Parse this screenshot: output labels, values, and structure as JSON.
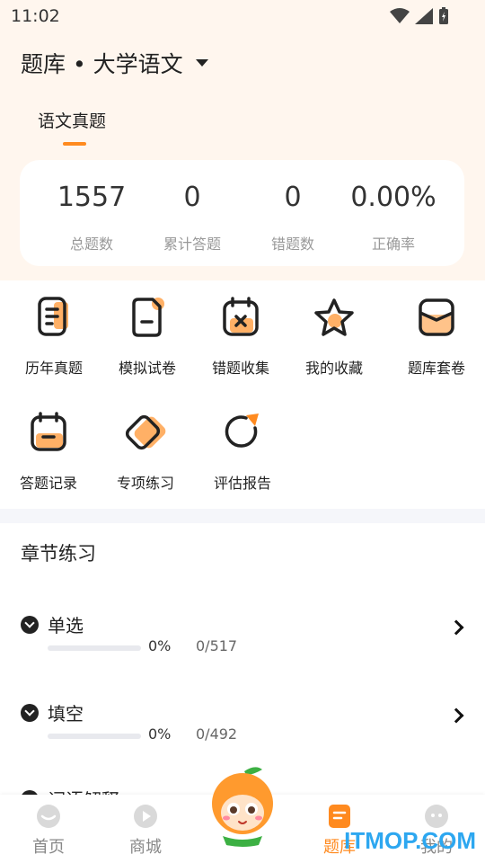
{
  "status_bar": {
    "time": "11:02"
  },
  "header": {
    "title": "题库 • 大学语文"
  },
  "tabs": [
    {
      "label": "语文真题",
      "active": true
    }
  ],
  "stats": [
    {
      "value": "1557",
      "label": "总题数"
    },
    {
      "value": "0",
      "label": "累计答题"
    },
    {
      "value": "0",
      "label": "错题数"
    },
    {
      "value": "0.00%",
      "label": "正确率"
    }
  ],
  "features": [
    {
      "label": "历年真题",
      "icon": "past-papers-icon"
    },
    {
      "label": "模拟试卷",
      "icon": "mock-exam-icon"
    },
    {
      "label": "错题收集",
      "icon": "wrong-collection-icon"
    },
    {
      "label": "我的收藏",
      "icon": "star-icon"
    },
    {
      "label": "题库套卷",
      "icon": "paper-set-icon"
    },
    {
      "label": "答题记录",
      "icon": "answer-record-icon"
    },
    {
      "label": "专项练习",
      "icon": "special-practice-icon"
    },
    {
      "label": "评估报告",
      "icon": "report-icon"
    }
  ],
  "section": {
    "title": "章节练习"
  },
  "chapters": [
    {
      "name": "单选",
      "percent": "0%",
      "progress": 0,
      "count": "0/517"
    },
    {
      "name": "填空",
      "percent": "0%",
      "progress": 0,
      "count": "0/492"
    },
    {
      "name": "词语解释"
    }
  ],
  "bottom_nav": [
    {
      "label": "首页",
      "icon": "home-icon",
      "active": false
    },
    {
      "label": "商城",
      "icon": "mall-icon",
      "active": false
    },
    {
      "label": "题库",
      "icon": "question-bank-icon",
      "active": true
    },
    {
      "label": "我的",
      "icon": "profile-icon",
      "active": false
    }
  ],
  "watermark": "ITMOP.COM",
  "colors": {
    "accent": "#ff8a1f",
    "background_top": "#fff6ee",
    "divider": "#f5f6fa"
  }
}
